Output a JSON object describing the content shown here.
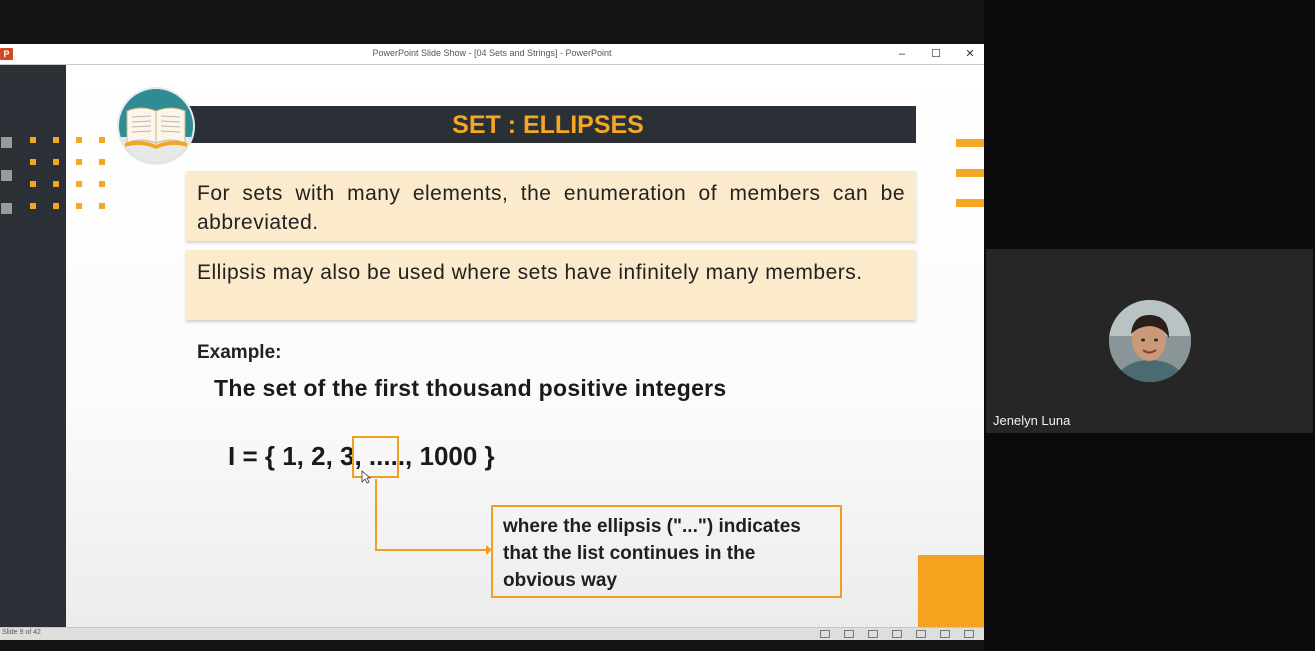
{
  "window": {
    "title": "PowerPoint Slide Show - [04 Sets and Strings] - PowerPoint",
    "app_icon": "P",
    "controls": {
      "minimize": "–",
      "maximize": "☐",
      "close": "✕"
    }
  },
  "slide": {
    "title": "SET : ELLIPSES",
    "callouts": [
      "For sets with many elements, the enumeration of members can be abbreviated.",
      "Ellipsis may also be used where sets have infinitely many members."
    ],
    "example_label": "Example:",
    "statement": "The set of the first thousand positive integers",
    "set_expression": "I = { 1, 2, 3, ....., 1000 }",
    "note": "where the ellipsis (\"...\") indicates that the list continues in the obvious way",
    "accent_color": "#f5a623",
    "dark_color": "#2b2f36"
  },
  "statusbar": {
    "slide_counter": "Slide 9 of 42"
  },
  "participant": {
    "name": "Jenelyn Luna"
  }
}
